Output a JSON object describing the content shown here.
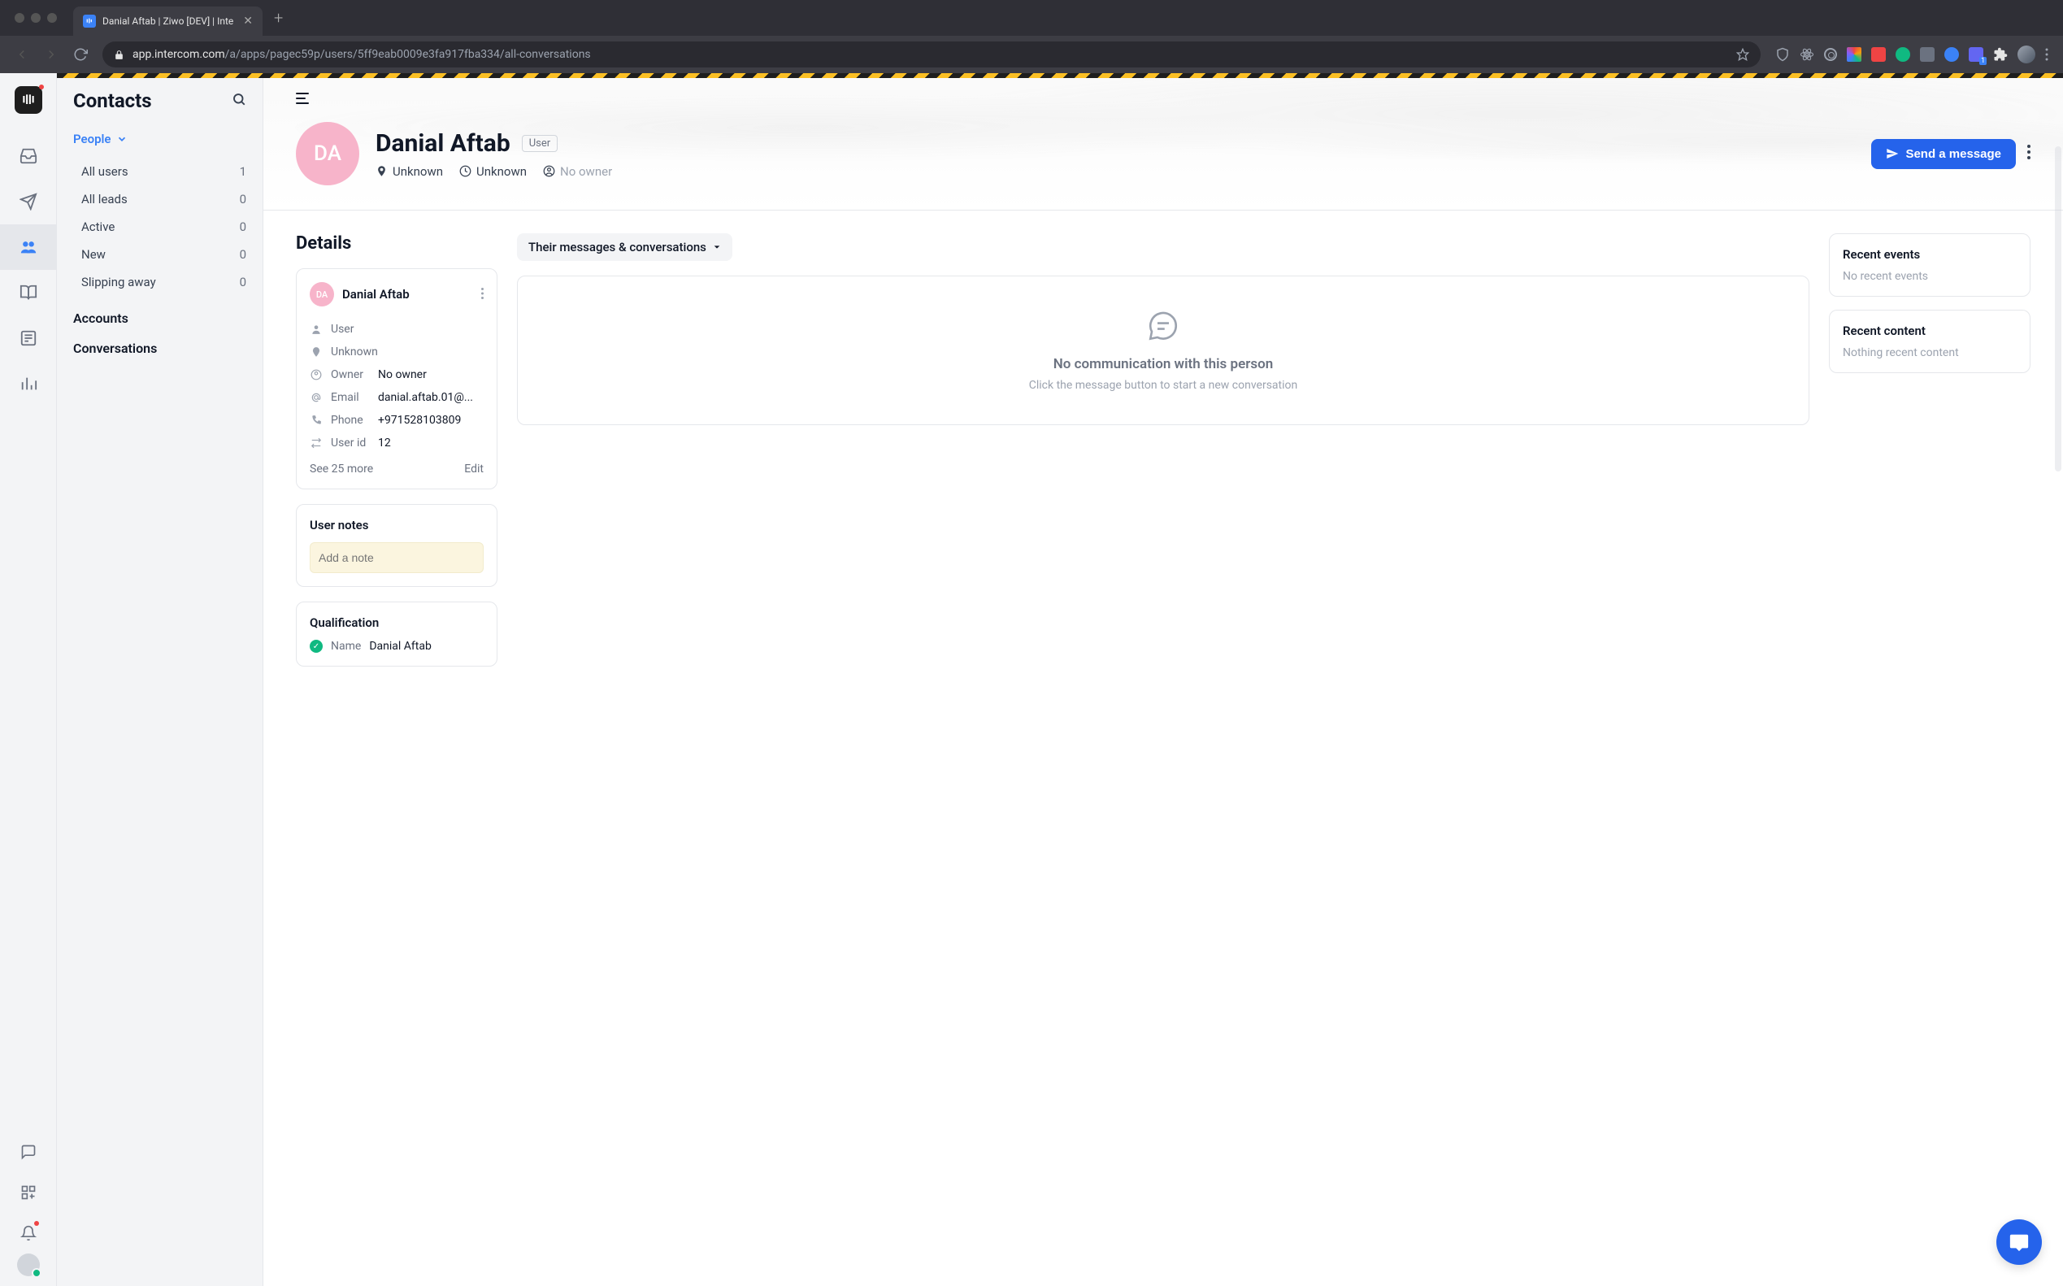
{
  "browser": {
    "tab_title": "Danial Aftab | Ziwo [DEV] | Inte",
    "url_host": "app.intercom.com",
    "url_path": "/a/apps/pagec59p/users/5ff9eab0009e3fa917fba334/all-conversations"
  },
  "sidebar": {
    "title": "Contacts",
    "section": "People",
    "items": [
      {
        "label": "All users",
        "count": "1"
      },
      {
        "label": "All leads",
        "count": "0"
      },
      {
        "label": "Active",
        "count": "0"
      },
      {
        "label": "New",
        "count": "0"
      },
      {
        "label": "Slipping away",
        "count": "0"
      }
    ],
    "links": {
      "accounts": "Accounts",
      "conversations": "Conversations"
    }
  },
  "hero": {
    "initials": "DA",
    "name": "Danial Aftab",
    "badge": "User",
    "location": "Unknown",
    "time": "Unknown",
    "owner": "No owner",
    "send_label": "Send a message"
  },
  "details": {
    "section_title": "Details",
    "card_name": "Danial Aftab",
    "card_initials": "DA",
    "type": "User",
    "location": "Unknown",
    "owner_label": "Owner",
    "owner_value": "No owner",
    "email_label": "Email",
    "email_value": "danial.aftab.01@...",
    "phone_label": "Phone",
    "phone_value": "+971528103809",
    "userid_label": "User id",
    "userid_value": "12",
    "see_more": "See 25 more",
    "edit": "Edit"
  },
  "conversations": {
    "dropdown_label": "Their messages & conversations",
    "empty_title": "No communication with this person",
    "empty_sub": "Click the message button to start a new conversation"
  },
  "notes": {
    "title": "User notes",
    "placeholder": "Add a note"
  },
  "qualification": {
    "title": "Qualification",
    "name_label": "Name",
    "name_value": "Danial Aftab"
  },
  "right_panels": {
    "events_title": "Recent events",
    "events_empty": "No recent events",
    "content_title": "Recent content",
    "content_empty": "Nothing recent content"
  }
}
